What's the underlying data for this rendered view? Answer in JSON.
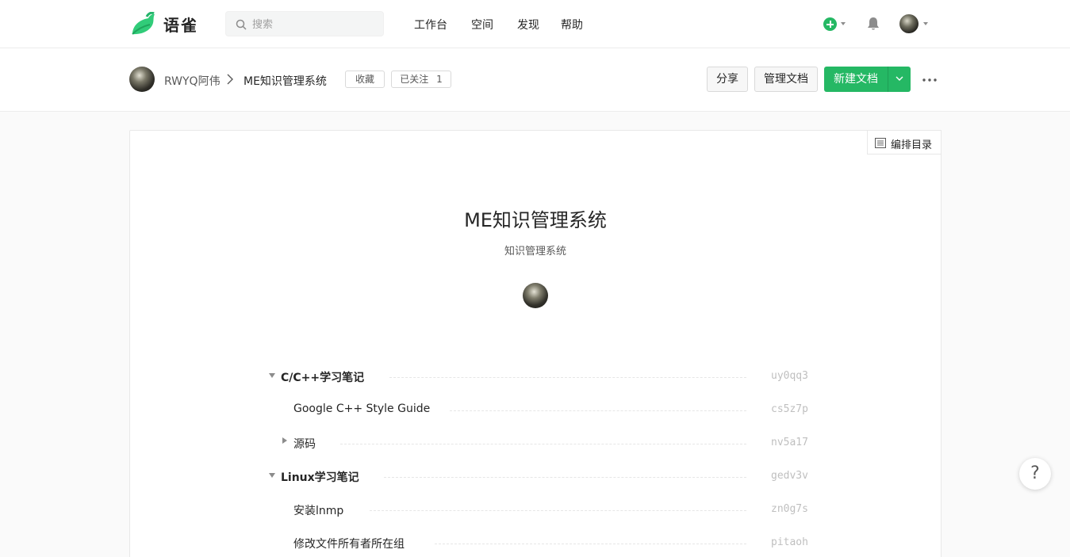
{
  "app": {
    "brand": "语雀"
  },
  "search": {
    "placeholder": "搜索"
  },
  "nav": {
    "items": [
      "工作台",
      "空间",
      "发现",
      "帮助"
    ]
  },
  "repo": {
    "owner": "RWYQ阿伟",
    "name": "ME知识管理系统",
    "favorite_label": "收藏",
    "follow_label": "已关注",
    "follow_count": "1",
    "share_label": "分享",
    "manage_label": "管理文档",
    "new_doc_label": "新建文档",
    "toc_edit_label": "编排目录",
    "title": "ME知识管理系统",
    "description": "知识管理系统"
  },
  "toc": [
    {
      "label": "C/C++学习笔记",
      "slug": "uy0qq3",
      "level": 0,
      "state": "expanded",
      "bold": true
    },
    {
      "label": "Google C++ Style Guide",
      "slug": "cs5z7p",
      "level": 1,
      "state": "leaf",
      "bold": false
    },
    {
      "label": "源码",
      "slug": "nv5a17",
      "level": 1,
      "state": "collapsed",
      "bold": false
    },
    {
      "label": "Linux学习笔记",
      "slug": "gedv3v",
      "level": 0,
      "state": "expanded",
      "bold": true
    },
    {
      "label": "安装lnmp",
      "slug": "zn0g7s",
      "level": 1,
      "state": "leaf",
      "bold": false
    },
    {
      "label": "修改文件所有者所在组",
      "slug": "pitaoh",
      "level": 1,
      "state": "leaf",
      "bold": false
    }
  ],
  "help": {
    "label": "?"
  },
  "colors": {
    "accent": "#25b864",
    "text": "#262626",
    "muted": "#bfbfbf"
  },
  "icons": [
    "logo-icon",
    "search-icon",
    "plus-icon",
    "bell-icon",
    "chevron-right-icon",
    "chevron-down-icon",
    "more-icon",
    "list-icon"
  ]
}
